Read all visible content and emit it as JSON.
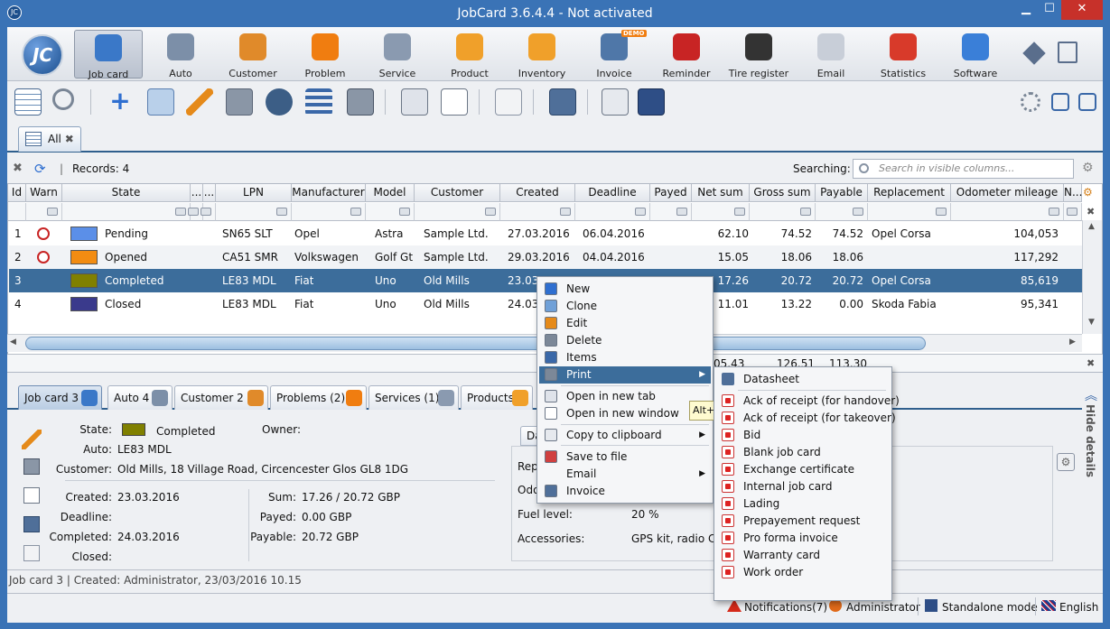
{
  "window": {
    "title": "JobCard 3.6.4.4 - Not activated"
  },
  "ribbon": [
    {
      "label": "Job card",
      "icon": "job-card-icon",
      "color": "#3a78c8",
      "selected": true
    },
    {
      "label": "Auto",
      "icon": "gear-icon",
      "color": "#7c8fa8"
    },
    {
      "label": "Customer",
      "icon": "customer-icon",
      "color": "#e08a2a"
    },
    {
      "label": "Problem",
      "icon": "warning-icon",
      "color": "#f07d10"
    },
    {
      "label": "Service",
      "icon": "tools-icon",
      "color": "#8a9ab0"
    },
    {
      "label": "Product",
      "icon": "box-icon",
      "color": "#f0a02a"
    },
    {
      "label": "Inventory",
      "icon": "boxes-icon",
      "color": "#f0a02a"
    },
    {
      "label": "Invoice",
      "icon": "invoice-icon",
      "color": "#4f77a8",
      "badge": "DEMO"
    },
    {
      "label": "Reminder",
      "icon": "reminder-icon",
      "color": "#c82424"
    },
    {
      "label": "Tire register",
      "icon": "tire-icon",
      "color": "#333333"
    },
    {
      "label": "Email",
      "icon": "envelope-icon",
      "color": "#c8ced8"
    },
    {
      "label": "Statistics",
      "icon": "pie-chart-icon",
      "color": "#d83a2a"
    },
    {
      "label": "Software",
      "icon": "software-icon",
      "color": "#3a7fd8"
    }
  ],
  "tabs": {
    "all": "All"
  },
  "records": {
    "label": "Records: 4",
    "searching": "Searching:",
    "search_placeholder": "Search in visible columns..."
  },
  "grid": {
    "headers": [
      "Id",
      "Warn",
      "State",
      "...",
      "...",
      "LPN",
      "Manufacturer",
      "Model",
      "Customer",
      "Created",
      "Deadline",
      "Payed",
      "Net sum",
      "Gross sum",
      "Payable",
      "Replacement",
      "Odometer mileage",
      "N..."
    ],
    "rows": [
      {
        "id": "1",
        "state": "Pending",
        "color": "#5b8fe8",
        "lpn": "SN65 SLT",
        "manufacturer": "Opel",
        "model": "Astra",
        "customer": "Sample Ltd.",
        "created": "27.03.2016",
        "deadline": "06.04.2016",
        "net": "62.10",
        "gross": "74.52",
        "payable": "74.52",
        "replacement": "Opel Corsa",
        "odometer": "104,053"
      },
      {
        "id": "2",
        "state": "Opened",
        "color": "#f28c12",
        "lpn": "CA51 SMR",
        "manufacturer": "Volkswagen",
        "model": "Golf Gt",
        "customer": "Sample Ltd.",
        "created": "29.03.2016",
        "deadline": "04.04.2016",
        "net": "15.05",
        "gross": "18.06",
        "payable": "18.06",
        "replacement": "",
        "odometer": "117,292"
      },
      {
        "id": "3",
        "state": "Completed",
        "color": "#808000",
        "lpn": "LE83 MDL",
        "manufacturer": "Fiat",
        "model": "Uno",
        "customer": "Old Mills",
        "created": "23.03",
        "deadline": "",
        "net": "17.26",
        "gross": "20.72",
        "payable": "20.72",
        "replacement": "Opel Corsa",
        "odometer": "85,619"
      },
      {
        "id": "4",
        "state": "Closed",
        "color": "#3a3a8c",
        "lpn": "LE83 MDL",
        "manufacturer": "Fiat",
        "model": "Uno",
        "customer": "Old Mills",
        "created": "24.03",
        "deadline": "",
        "net": "11.01",
        "gross": "13.22",
        "payable": "0.00",
        "replacement": "Skoda Fabia",
        "odometer": "95,341"
      }
    ],
    "totals": {
      "net": "05.43",
      "gross": "126.51",
      "payable": "113.30"
    }
  },
  "detail_tabs": [
    "Job card 3",
    "Auto 4",
    "Customer 2",
    "Problems (2)",
    "Services (1)",
    "Products (1)"
  ],
  "details": {
    "state_label": "State:",
    "state_value": "Completed",
    "state_color": "#808000",
    "owner_label": "Owner:",
    "auto_label": "Auto:",
    "auto_value": "LE83 MDL",
    "customer_label": "Customer:",
    "customer_value": "Old Mills, 18 Village Road, Circencester Glos GL8 1DG",
    "created_label": "Created:",
    "created_value": "23.03.2016",
    "deadline_label": "Deadline:",
    "deadline_value": "",
    "completed_label": "Completed:",
    "completed_value": "24.03.2016",
    "closed_label": "Closed:",
    "sum_label": "Sum:",
    "sum_value": "17.26 / 20.72 GBP",
    "payed_label": "Payed:",
    "payed_value": "0.00 GBP",
    "payable_label": "Payable:",
    "payable_value": "20.72 GBP",
    "right_tab": "Da",
    "rep_label": "Rep",
    "odo_label": "Odo",
    "fuel_label": "Fuel level:",
    "fuel_value": "20 %",
    "accessories_label": "Accessories:",
    "accessories_value": "GPS kit, radio CD",
    "hide_details": "Hide details"
  },
  "status": {
    "text": "Job card 3 | Created: Administrator, 23/03/2016 10.15"
  },
  "bottombar": {
    "notifications": "Notifications(7)",
    "user": "Administrator",
    "mode": "Standalone mode",
    "language": "English"
  },
  "context_menu": {
    "items": [
      "New",
      "Clone",
      "Edit",
      "Delete",
      "Items",
      "Print",
      "Open in new tab",
      "Open in new window",
      "Copy to clipboard",
      "Save to file",
      "Email",
      "Invoice"
    ],
    "tooltip": "Alt+N"
  },
  "print_submenu": [
    "Datasheet",
    "Ack of receipt (for handover)",
    "Ack of receipt (for takeover)",
    "Bid",
    "Blank job card",
    "Exchange certificate",
    "Internal job card",
    "Lading",
    "Prepayement request",
    "Pro forma invoice",
    "Warranty card",
    "Work order"
  ]
}
